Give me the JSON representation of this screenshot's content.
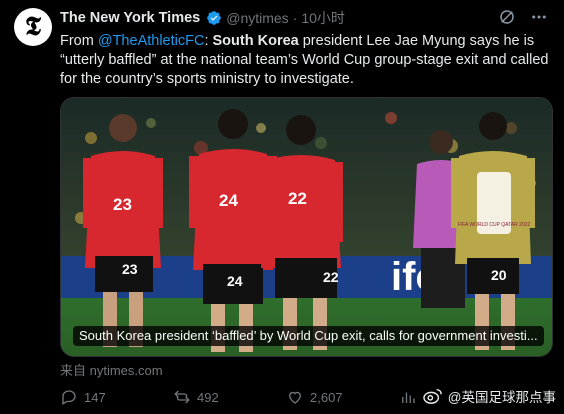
{
  "tweet": {
    "author_name": "The New York Times",
    "handle": "@nytimes",
    "separator": "·",
    "time": "10小时",
    "text_prefix": "From ",
    "mention": "@TheAthleticFC",
    "text_colon": ": ",
    "bold_country": "South Korea",
    "text_rest": " president Lee Jae Myung says he is “utterly baffled” at the national team’s World Cup group-stage exit and called for the country’s sports ministry to investigate."
  },
  "media": {
    "caption": "South Korea president ‘baffled’ by World Cup exit, calls for government investi...",
    "jersey_numbers": [
      "23",
      "24",
      "22",
      "20"
    ],
    "sponsor_text": "ifor",
    "goalkeeper_badge": "FIFA WORLD CUP QATAR 2022"
  },
  "source": "来自 nytimes.com",
  "stats": {
    "replies": "147",
    "retweets": "492",
    "likes": "2,607"
  },
  "watermark": "@英国足球那点事",
  "colors": {
    "accent": "#1d9bf0",
    "muted": "#71767b",
    "jersey_red": "#d7272f",
    "shorts_black": "#111111",
    "gk_jersey": "#b8a84a"
  }
}
